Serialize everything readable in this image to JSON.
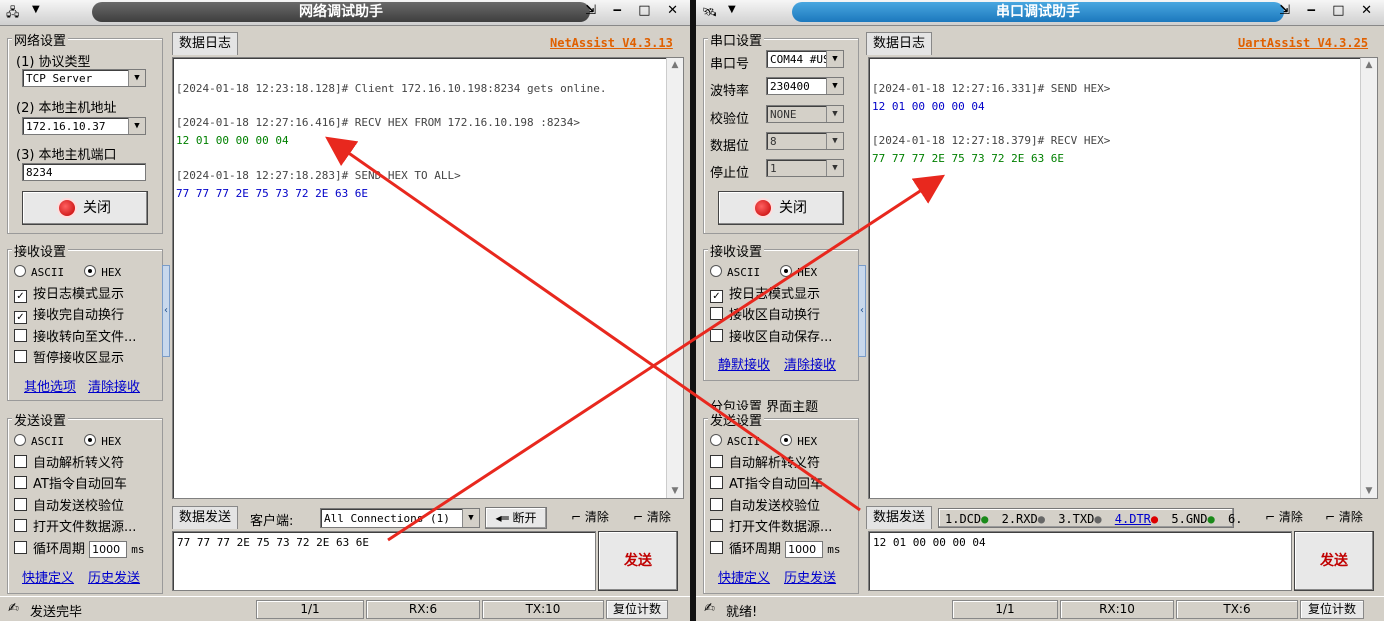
{
  "left": {
    "title": "网络调试助手",
    "version": "NetAssist V4.3.13",
    "net_settings": {
      "title": "网络设置",
      "protocol_label": "(1) 协议类型",
      "protocol_value": "TCP Server",
      "host_label": "(2) 本地主机地址",
      "host_value": "172.16.10.37",
      "port_label": "(3) 本地主机端口",
      "port_value": "8234",
      "close_label": "关闭"
    },
    "recv_settings": {
      "title": "接收设置",
      "ascii": "ASCII",
      "hex": "HEX",
      "opt1": "按日志模式显示",
      "opt2": "接收完自动换行",
      "opt3": "接收转向至文件...",
      "opt4": "暂停接收区显示",
      "link1": "其他选项",
      "link2": "清除接收"
    },
    "send_settings": {
      "title": "发送设置",
      "ascii": "ASCII",
      "hex": "HEX",
      "opt1": "自动解析转义符",
      "opt2": "AT指令自动回车",
      "opt3": "自动发送校验位",
      "opt4": "打开文件数据源...",
      "opt5": "循环周期",
      "period_value": "1000",
      "period_unit": "ms",
      "link1": "快捷定义",
      "link2": "历史发送"
    },
    "log_tab": "数据日志",
    "log": [
      {
        "head": "[2024-01-18 12:23:18.128]# Client 172.16.10.198:8234 gets online.",
        "body": ""
      },
      {
        "head": "[2024-01-18 12:27:16.416]# RECV HEX FROM 172.16.10.198 :8234>",
        "body": "12 01 00 00 00 04"
      },
      {
        "head": "[2024-01-18 12:27:18.283]# SEND HEX TO ALL>",
        "body": "77 77 77 2E 75 73 72 2E 63 6E"
      }
    ],
    "send_tab": "数据发送",
    "client_label": "客户端:",
    "client_value": "All Connections (1)",
    "disconnect_label": "断开",
    "clear1": "清除",
    "clear2": "清除",
    "send_text": "77 77 77 2E 75 73 72 2E 63 6E",
    "send_button": "发送",
    "status_text": "发送完毕",
    "status_count": "1/1",
    "rx": "RX:6",
    "tx": "TX:10",
    "reset": "复位计数"
  },
  "right": {
    "title": "串口调试助手",
    "version": "UartAssist V4.3.25",
    "serial": {
      "title": "串口设置",
      "port_label": "串口号",
      "port_value": "COM44 #US",
      "baud_label": "波特率",
      "baud_value": "230400",
      "parity_label": "校验位",
      "parity_value": "NONE",
      "data_label": "数据位",
      "data_value": "8",
      "stop_label": "停止位",
      "stop_value": "1",
      "close_label": "关闭"
    },
    "recv_settings": {
      "title": "接收设置",
      "ascii": "ASCII",
      "hex": "HEX",
      "opt1": "按日志模式显示",
      "opt2": "接收区自动换行",
      "opt3": "接收区自动保存...",
      "link1": "静默接收",
      "link2": "清除接收"
    },
    "tabs_row": "分包设置   界面主题",
    "send_settings": {
      "title": "发送设置",
      "ascii": "ASCII",
      "hex": "HEX",
      "opt1": "自动解析转义符",
      "opt2": "AT指令自动回车",
      "opt3": "自动发送校验位",
      "opt4": "打开文件数据源...",
      "opt5": "循环周期",
      "period_value": "1000",
      "period_unit": "ms",
      "link1": "快捷定义",
      "link2": "历史发送"
    },
    "log_tab": "数据日志",
    "log": [
      {
        "head": "[2024-01-18 12:27:16.331]# SEND HEX>",
        "body": "12 01 00 00 00 04"
      },
      {
        "head": "[2024-01-18 12:27:18.379]# RECV HEX>",
        "body": "77 77 77 2E 75 73 72 2E 63 6E"
      }
    ],
    "send_tab": "数据发送",
    "signals": [
      "1.DCD",
      "2.RXD",
      "3.TXD",
      "4.DTR",
      "5.GND",
      "6."
    ],
    "clear1": "清除",
    "clear2": "清除",
    "send_text": "12 01 00 00 00 04",
    "send_button": "发送",
    "status_text": "就绪!",
    "status_count": "1/1",
    "rx": "RX:10",
    "tx": "TX:6",
    "reset": "复位计数"
  },
  "colors": {
    "arrow": "#e8281e",
    "recv_text": "#008000",
    "send_text": "#0000c8",
    "version": "#e06000"
  }
}
